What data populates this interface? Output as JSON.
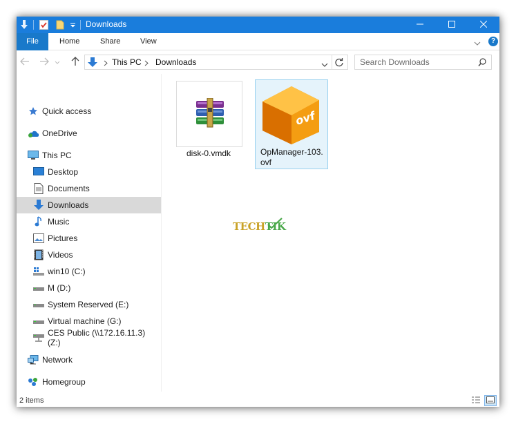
{
  "window": {
    "title": "Downloads",
    "accent_color": "#1a7ddc",
    "controls": {
      "minimize": "minimize-icon",
      "maximize": "maximize-icon",
      "close": "close-icon"
    }
  },
  "ribbon": {
    "tabs": [
      {
        "label": "File"
      },
      {
        "label": "Home"
      },
      {
        "label": "Share"
      },
      {
        "label": "View"
      }
    ]
  },
  "address": {
    "breadcrumb": [
      "This PC",
      "Downloads"
    ]
  },
  "search": {
    "placeholder": "Search Downloads"
  },
  "nav": {
    "items": [
      {
        "label": "Quick access",
        "icon": "star-icon"
      },
      {
        "label": "OneDrive",
        "icon": "onedrive-icon"
      },
      {
        "label": "This PC",
        "icon": "computer-icon"
      },
      {
        "label": "Desktop",
        "icon": "desktop-icon"
      },
      {
        "label": "Documents",
        "icon": "documents-icon"
      },
      {
        "label": "Downloads",
        "icon": "download-arrow-icon",
        "selected": true
      },
      {
        "label": "Music",
        "icon": "music-note-icon"
      },
      {
        "label": "Pictures",
        "icon": "pictures-icon"
      },
      {
        "label": "Videos",
        "icon": "film-icon"
      },
      {
        "label": "win10 (C:)",
        "icon": "windows-drive-icon"
      },
      {
        "label": "M (D:)",
        "icon": "drive-icon"
      },
      {
        "label": "System Reserved (E:)",
        "icon": "drive-icon"
      },
      {
        "label": "Virtual machine (G:)",
        "icon": "drive-icon"
      },
      {
        "label": "CES Public (\\\\172.16.11.3) (Z:)",
        "icon": "network-drive-icon"
      },
      {
        "label": "Network",
        "icon": "network-icon"
      },
      {
        "label": "Homegroup",
        "icon": "homegroup-icon"
      }
    ]
  },
  "files": [
    {
      "name": "disk-0.vmdk",
      "icon": "winrar-archive-icon"
    },
    {
      "name_line1": "OpManager-103.",
      "name_line2": "ovf",
      "icon": "ovf-box-icon",
      "badge": "ovf"
    }
  ],
  "watermark": {
    "text_a": "TECH",
    "text_b": "TIK"
  },
  "status": {
    "items": "2 items"
  }
}
